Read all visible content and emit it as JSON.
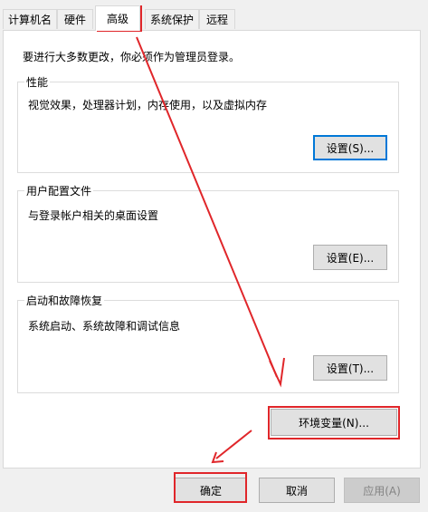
{
  "tabs": [
    {
      "label": "计算机名"
    },
    {
      "label": "硬件"
    },
    {
      "label": "高级"
    },
    {
      "label": "系统保护"
    },
    {
      "label": "远程"
    }
  ],
  "intro": "要进行大多数更改，你必须作为管理员登录。",
  "performance": {
    "title": "性能",
    "description": "视觉效果，处理器计划，内存使用，以及虚拟内存",
    "button": "设置(S)..."
  },
  "user_profile": {
    "title": "用户配置文件",
    "description": "与登录帐户相关的桌面设置",
    "button": "设置(E)..."
  },
  "startup_recovery": {
    "title": "启动和故障恢复",
    "description": "系统启动、系统故障和调试信息",
    "button": "设置(T)..."
  },
  "env_button": "环境变量(N)...",
  "footer": {
    "ok": "确定",
    "cancel": "取消",
    "apply": "应用(A)"
  },
  "colors": {
    "annotation": "#e0262a",
    "focus": "#0078d7"
  }
}
